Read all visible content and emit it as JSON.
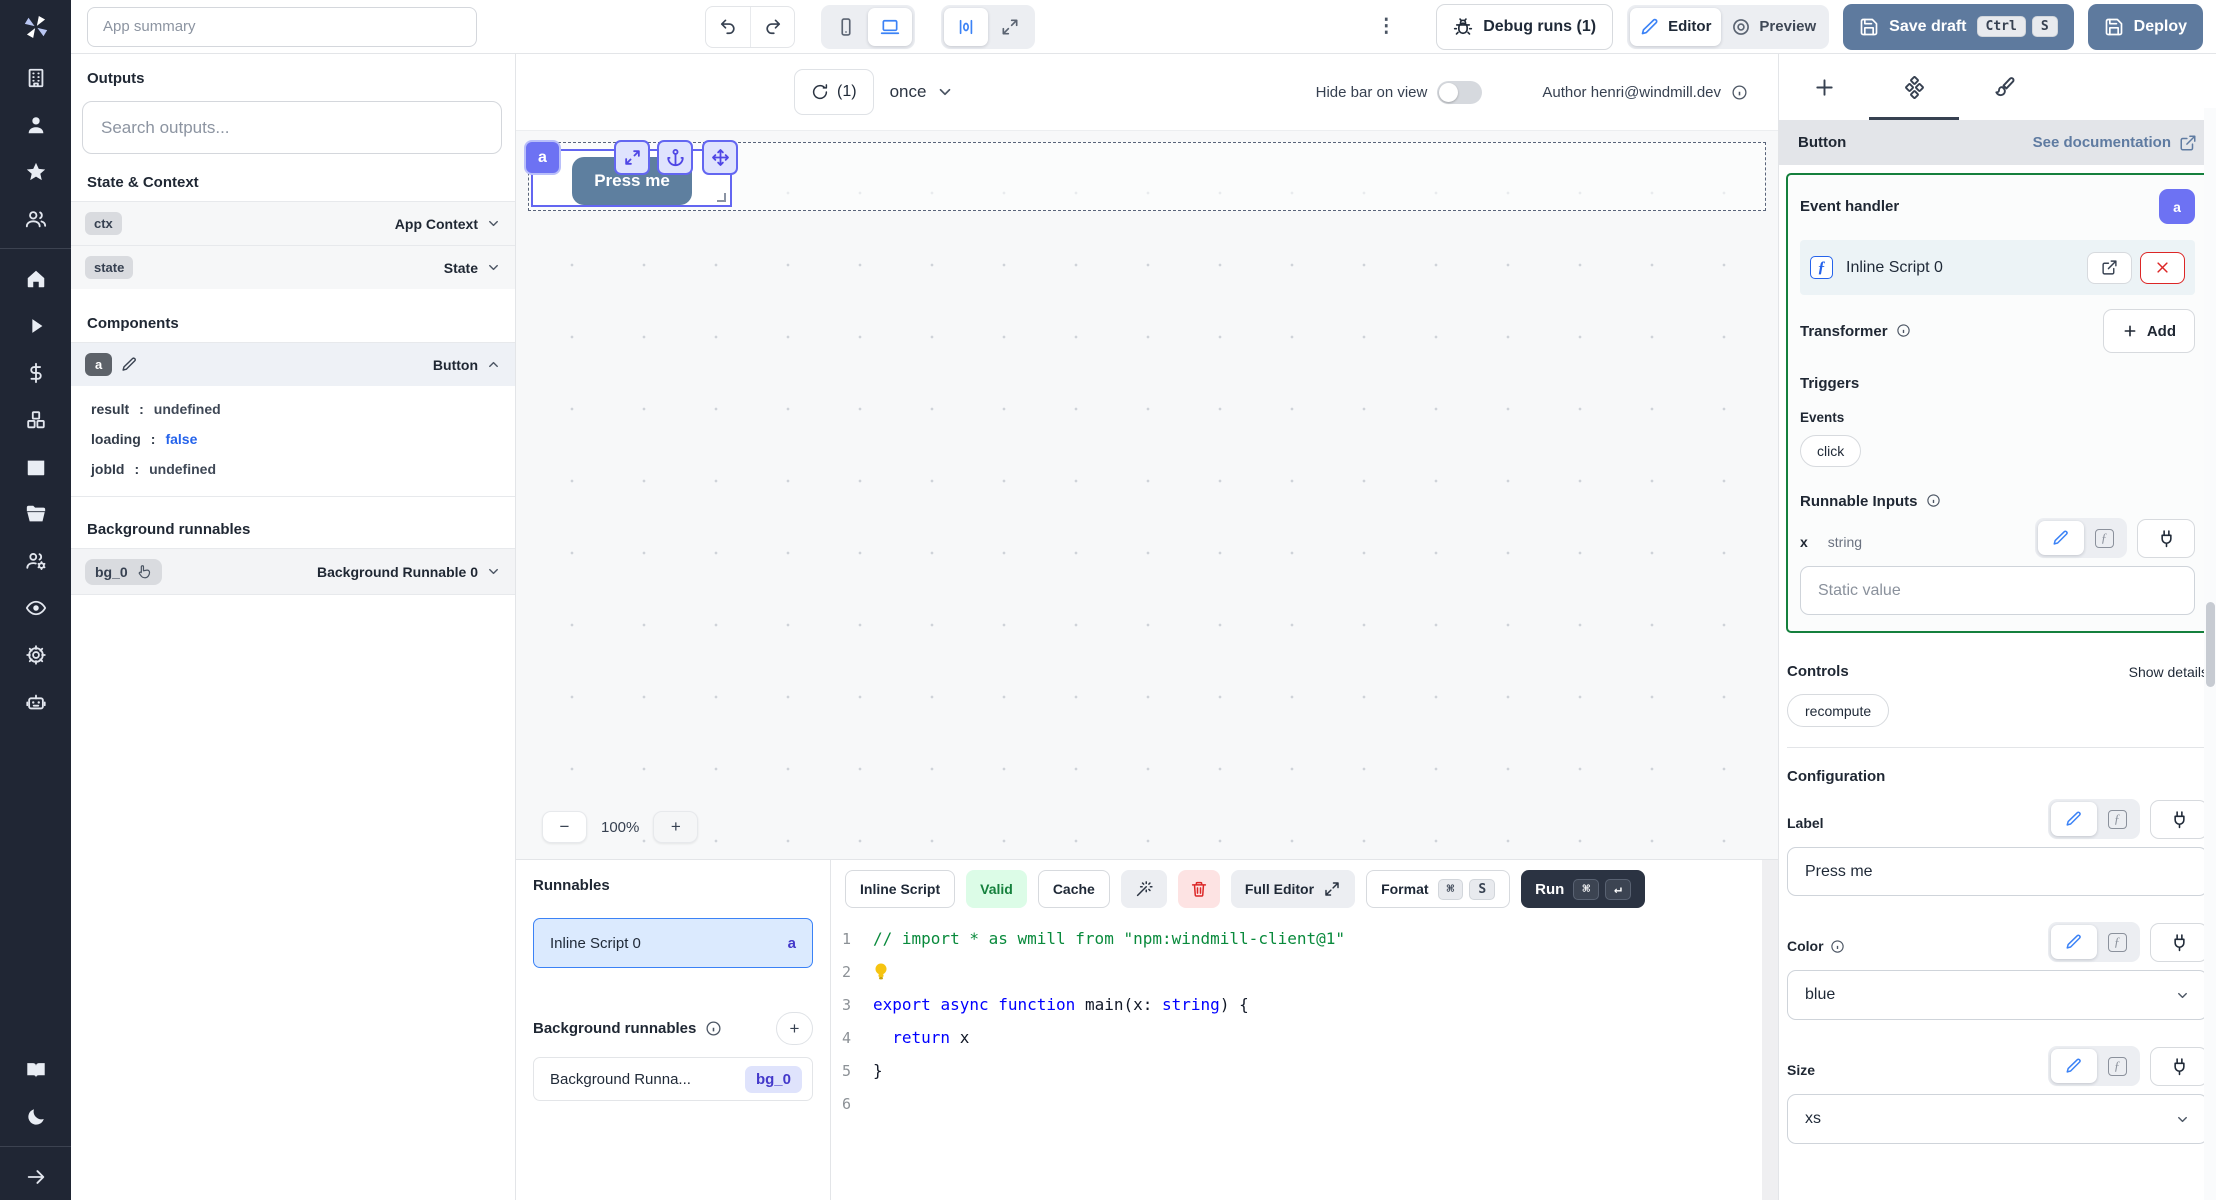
{
  "topbar": {
    "app_summary_placeholder": "App summary",
    "debug_runs": "Debug runs (1)",
    "editor": "Editor",
    "preview": "Preview",
    "save_draft": "Save draft",
    "save_keys": [
      "Ctrl",
      "S"
    ],
    "deploy": "Deploy"
  },
  "outputs_panel": {
    "title": "Outputs",
    "search_placeholder": "Search outputs...",
    "state_context_title": "State & Context",
    "rows": [
      {
        "badge": "ctx",
        "type": "App Context"
      },
      {
        "badge": "state",
        "type": "State"
      }
    ],
    "components_title": "Components",
    "component": {
      "badge": "a",
      "type": "Button",
      "props": [
        {
          "key": "result",
          "colon": ":",
          "value": "undefined"
        },
        {
          "key": "loading",
          "colon": ":",
          "value": "false"
        },
        {
          "key": "jobId",
          "colon": ":",
          "value": "undefined"
        }
      ]
    },
    "background_title": "Background runnables",
    "background_row": {
      "badge": "bg_0",
      "type": "Background Runnable 0"
    }
  },
  "canvas": {
    "refresh_count": "(1)",
    "schedule": "once",
    "hide_bar_label": "Hide bar on view",
    "author": "Author henri@windmill.dev",
    "component_tag": "a",
    "button_label": "Press me",
    "zoom_out": "−",
    "zoom_value": "100%",
    "zoom_in": "+"
  },
  "runnables_panel": {
    "title": "Runnables",
    "item": {
      "label": "Inline Script 0",
      "badge": "a"
    },
    "background_title": "Background runnables",
    "add_label": "+",
    "bg_item": {
      "label": "Background Runna...",
      "badge": "bg_0"
    }
  },
  "editor": {
    "lang": "Inline Script",
    "valid": "Valid",
    "cache": "Cache",
    "full_editor": "Full Editor",
    "format": "Format",
    "format_keys": [
      "⌘",
      "S"
    ],
    "run": "Run",
    "run_keys": [
      "⌘",
      "↵"
    ],
    "code": [
      {
        "n": "1",
        "tokens": [
          {
            "t": "// import * as wmill from \"npm:windmill-client@1\"",
            "c": "cmt"
          }
        ]
      },
      {
        "n": "2",
        "tokens": [
          {
            "t": "",
            "c": "bulb"
          }
        ]
      },
      {
        "n": "3",
        "tokens": [
          {
            "t": "export",
            "c": "kw"
          },
          {
            "t": " ",
            "c": "pl"
          },
          {
            "t": "async",
            "c": "kw"
          },
          {
            "t": " ",
            "c": "pl"
          },
          {
            "t": "function",
            "c": "kw"
          },
          {
            "t": " main(x: ",
            "c": "pl"
          },
          {
            "t": "string",
            "c": "kw"
          },
          {
            "t": ") {",
            "c": "pl"
          }
        ]
      },
      {
        "n": "4",
        "tokens": [
          {
            "t": "  ",
            "c": "pl"
          },
          {
            "t": "return",
            "c": "kw"
          },
          {
            "t": " x",
            "c": "pl"
          }
        ]
      },
      {
        "n": "5",
        "tokens": [
          {
            "t": "}",
            "c": "pl"
          }
        ]
      },
      {
        "n": "6",
        "tokens": []
      }
    ]
  },
  "right_panel": {
    "component_type": "Button",
    "doc_link": "See documentation",
    "event_handler": "Event handler",
    "badge": "a",
    "script_label": "Inline Script 0",
    "transformer": "Transformer",
    "add": "Add",
    "triggers": "Triggers",
    "events": "Events",
    "event_pill": "click",
    "runnable_inputs": "Runnable Inputs",
    "input_x": {
      "name": "x",
      "type": "string",
      "placeholder": "Static value"
    },
    "controls": {
      "title": "Controls",
      "show_details": "Show details",
      "pill": "recompute"
    },
    "configuration": "Configuration",
    "label_field": {
      "label": "Label",
      "value": "Press me"
    },
    "color_field": {
      "label": "Color",
      "value": "blue"
    },
    "size_field": {
      "label": "Size",
      "value": "xs"
    }
  }
}
